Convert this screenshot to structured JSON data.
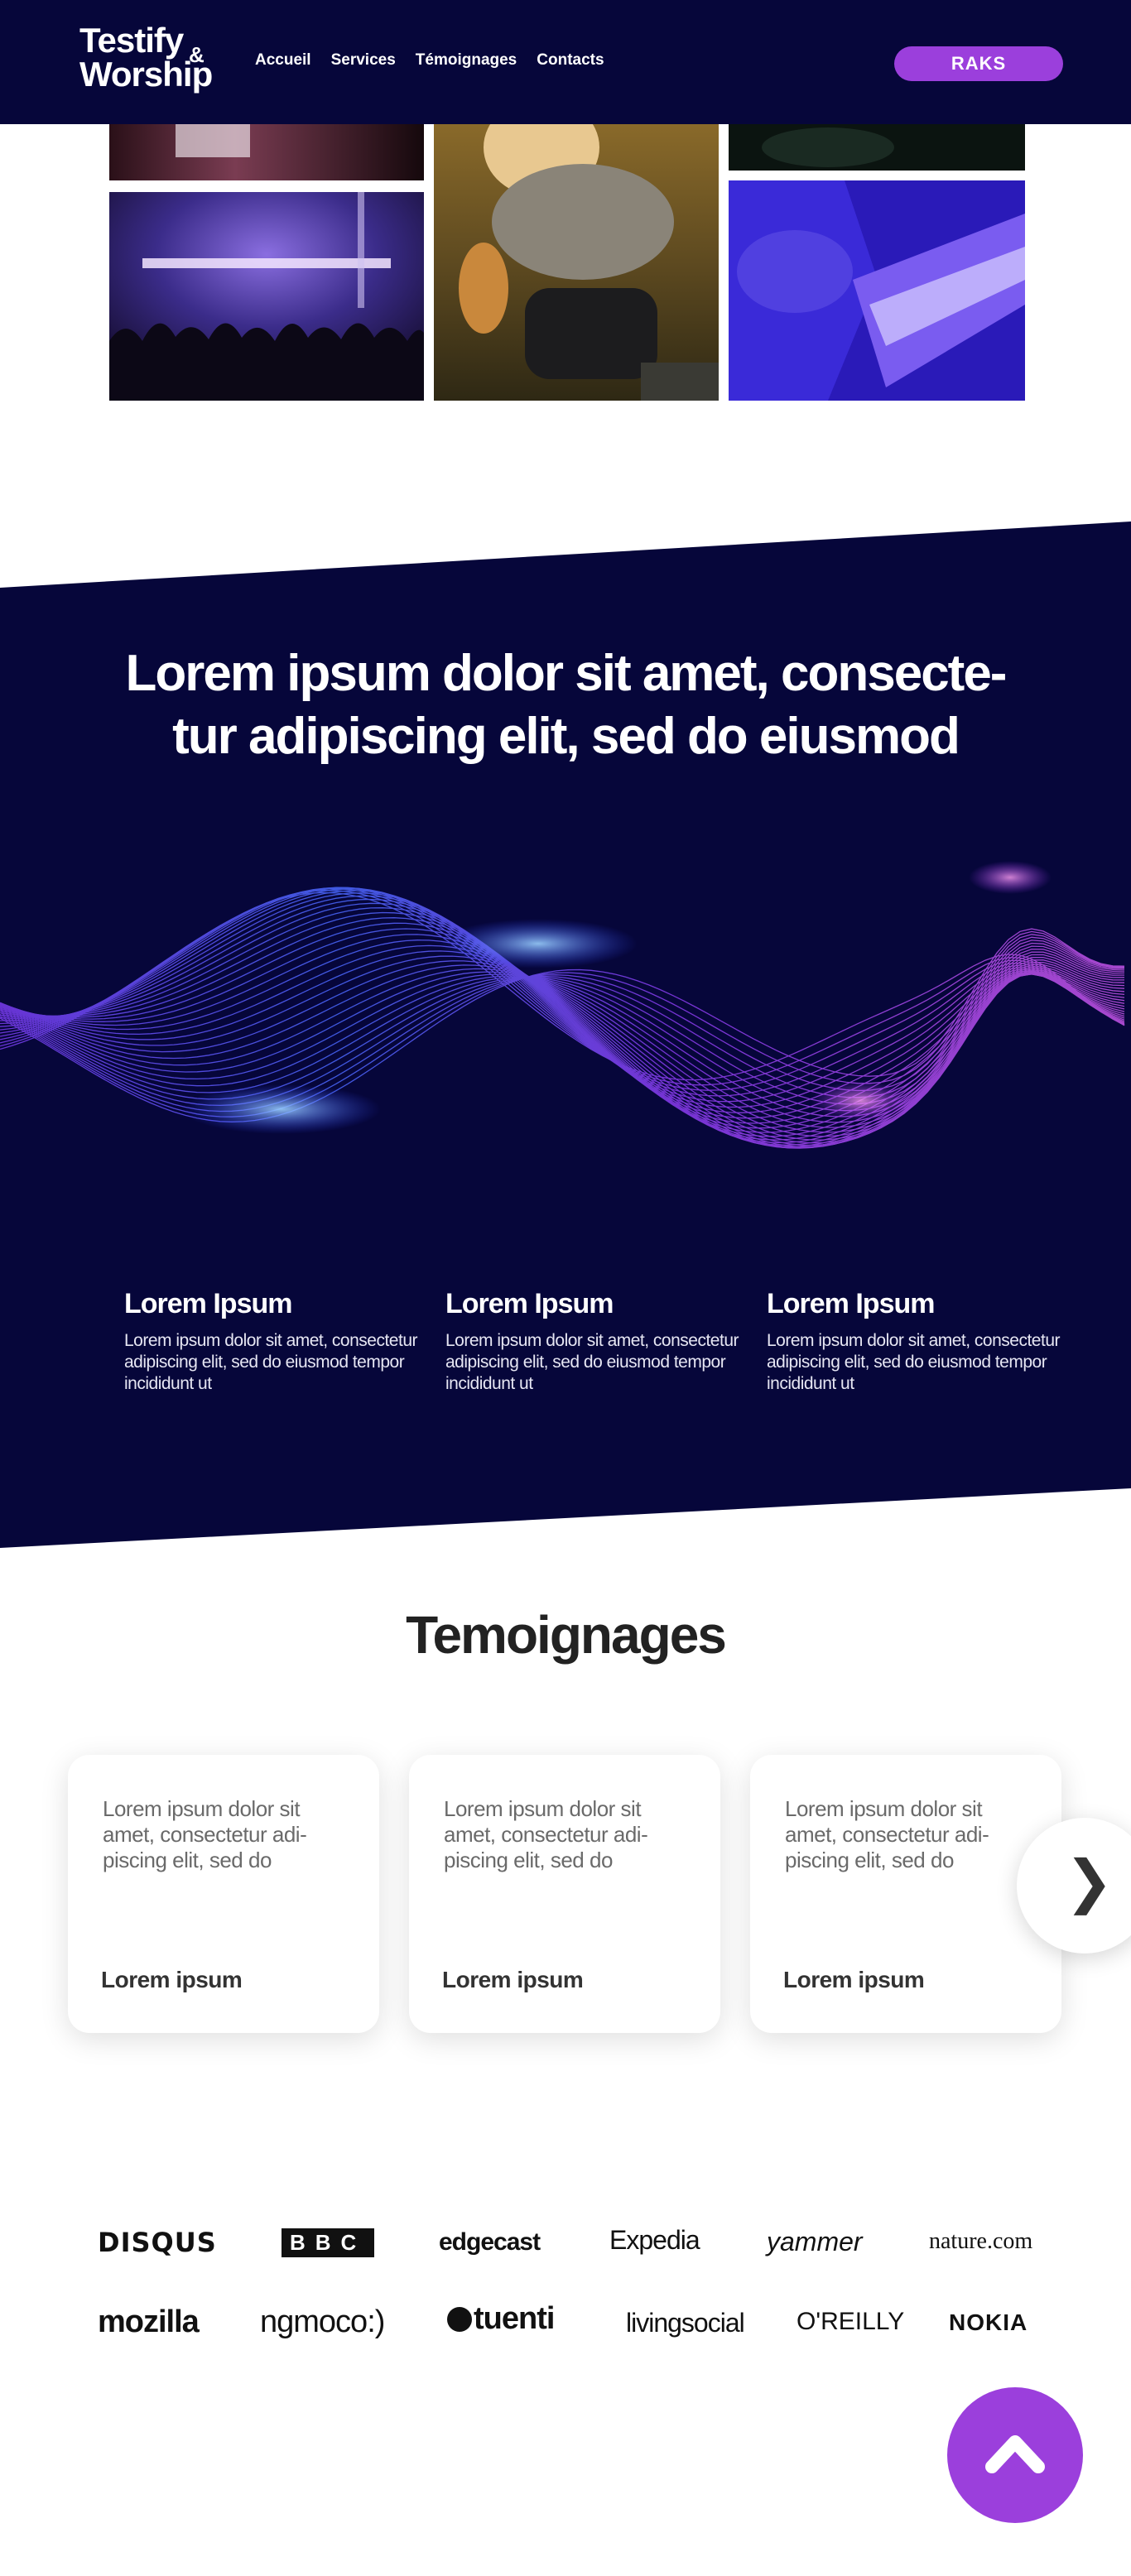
{
  "header": {
    "brand_line1": "Testify",
    "brand_amp": "&",
    "brand_line2": "Worship",
    "nav": [
      "Accueil",
      "Services",
      "Témoignages",
      "Contacts"
    ],
    "cta_label": "RAKS"
  },
  "hero": {
    "headline_line1": "Lorem ipsum dolor sit amet, consecte-",
    "headline_line2": "tur adipiscing elit, sed do eiusmod"
  },
  "features": [
    {
      "title": "Lorem Ipsum",
      "text": "Lorem ipsum dolor sit amet, consectetur adipiscing elit, sed do eiusmod tempor incididunt ut"
    },
    {
      "title": "Lorem Ipsum",
      "text": "Lorem ipsum dolor sit amet, consectetur adipiscing elit, sed do eiusmod tempor incididunt ut"
    },
    {
      "title": "Lorem Ipsum",
      "text": "Lorem ipsum dolor sit amet, consectetur adipiscing elit, sed do eiusmod tempor incididunt ut"
    }
  ],
  "testimonials": {
    "title": "Temoignages",
    "cards": [
      {
        "quote": "Lorem ipsum dolor sit amet, consectetur adi-piscing elit, sed do",
        "author": "Lorem ipsum"
      },
      {
        "quote": "Lorem ipsum dolor sit amet, consectetur adi-piscing elit, sed do",
        "author": "Lorem ipsum"
      },
      {
        "quote": "Lorem ipsum dolor sit amet, consectetur adi-piscing elit, sed do",
        "author": "Lorem ipsum"
      }
    ],
    "next_icon": "chevron-right-icon"
  },
  "partners": {
    "row1": [
      "DISQUS",
      "BBC",
      "edgecast",
      "Expedia",
      "yammer",
      "nature.com"
    ],
    "row2": [
      "mozilla",
      "ngmoco:)",
      "tuenti",
      "livingsocial",
      "O'REILLY",
      "NOKIA"
    ]
  },
  "colors": {
    "navy": "#06063a",
    "accent_purple": "#9b3fdc"
  }
}
